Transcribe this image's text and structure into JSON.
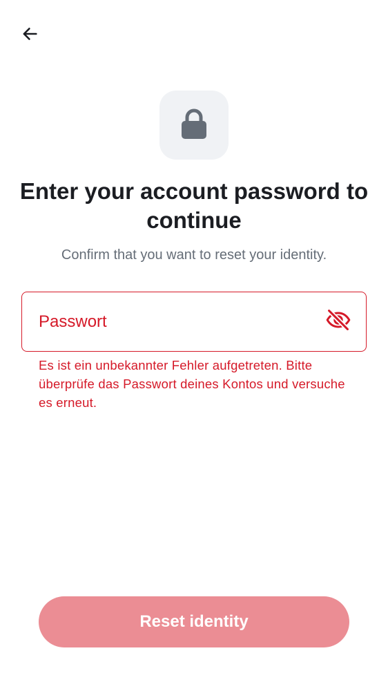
{
  "header": {
    "back_icon": "arrow-left-icon"
  },
  "hero": {
    "icon": "lock-icon",
    "title": "Enter your account password to continue",
    "subtitle": "Confirm that you want to reset your identity."
  },
  "password_field": {
    "placeholder": "Passwort",
    "value": "",
    "toggle_icon": "eye-off-icon",
    "error": "Es ist ein unbekannter Fehler aufgetreten. Bitte überprüfe das Passwort deines Kontos und versuche es erneut."
  },
  "actions": {
    "reset_label": "Reset identity"
  },
  "colors": {
    "error": "#d51928",
    "button_disabled": "#eb8d94",
    "icon_tile": "#f0f2f5",
    "icon_gray": "#656d77",
    "text_primary": "#1b1d22"
  }
}
